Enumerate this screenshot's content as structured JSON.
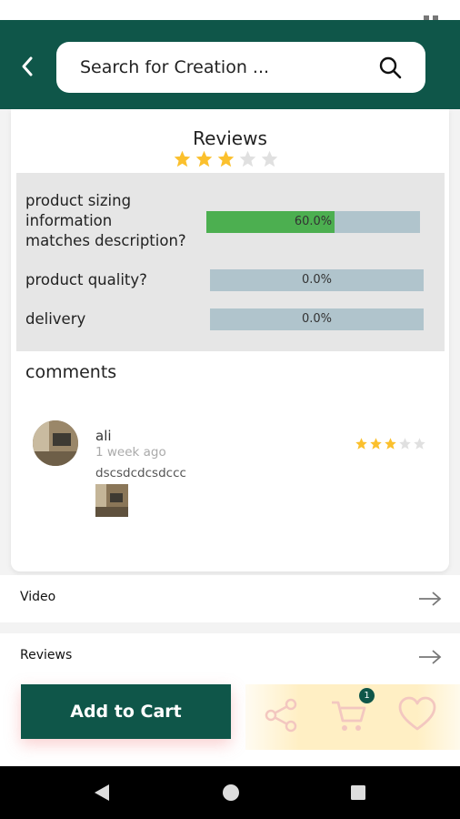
{
  "search": {
    "placeholder": "Search for Creation ..."
  },
  "icons": {
    "back": "back-arrow-icon",
    "search": "search-icon",
    "share": "share-icon",
    "cart": "cart-icon",
    "favorite": "heart-icon",
    "section_arrow": "right-arrow-icon"
  },
  "reviews": {
    "title": "Reviews",
    "rating": 3,
    "max_rating": 5,
    "criteria": [
      {
        "label_lines": [
          "product sizing",
          "information",
          "matches description?"
        ],
        "percent_text": "60.0%",
        "percent": 60
      },
      {
        "label": "product quality?",
        "percent_text": "0.0%",
        "percent": 0
      },
      {
        "label": "delivery",
        "percent_text": "0.0%",
        "percent": 0
      }
    ]
  },
  "comments": {
    "title": "comments",
    "items": [
      {
        "name": "ali",
        "time": "1 week ago",
        "text": "dscsdcdcsdccc",
        "rating": 3,
        "max_rating": 5
      }
    ]
  },
  "sections": [
    {
      "label": "Video"
    },
    {
      "label": "Reviews"
    }
  ],
  "bottom_bar": {
    "add_to_cart_label": "Add to Cart",
    "cart_count": "1"
  },
  "colors": {
    "primary": "#0f5649",
    "star": "#fbc02d",
    "star_empty": "#e0e0e0",
    "bar_fill": "#4caf50",
    "bar_bg": "#b0c4cc"
  }
}
